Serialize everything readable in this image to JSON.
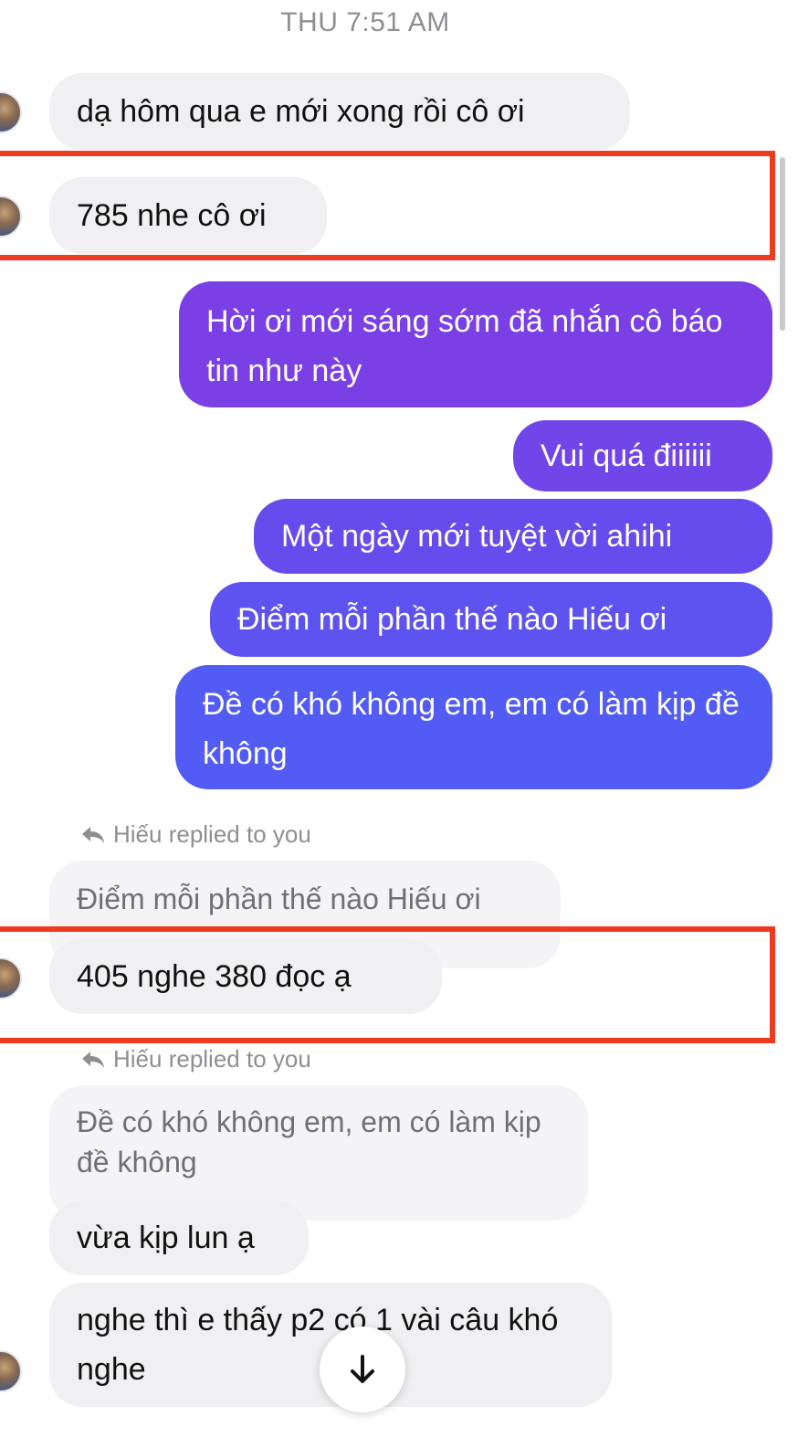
{
  "header": {
    "timestamp": "THU 7:51 AM"
  },
  "messages": [
    {
      "text": "dạ hôm qua e mới xong rồi cô ơi"
    },
    {
      "text": "785 nhe cô ơi"
    },
    {
      "text": "Hời ơi mới sáng sớm đã nhắn cô báo tin như này"
    },
    {
      "text": "Vui quá điiiiii"
    },
    {
      "text": "Một ngày mới tuyệt vời ahihi"
    },
    {
      "text": "Điểm mỗi phần thế nào Hiếu ơi"
    },
    {
      "text": "Đề có khó không em, em có làm kịp đề không"
    },
    {
      "reply_label": "Hiếu replied to you",
      "quote": "Điểm mỗi phần thế nào Hiếu ơi",
      "text": "405 nghe 380 đọc ạ"
    },
    {
      "reply_label": "Hiếu replied to you",
      "quote": "Đề có khó không em, em có làm kịp đề không",
      "text": "vừa kịp lun ạ"
    },
    {
      "text": "nghe thì e thấy p2 có 1 vài câu khó nghe"
    }
  ],
  "icons": {
    "reply": "reply-arrow-icon",
    "scroll_down": "arrow-down-icon"
  },
  "colors": {
    "highlight": "#ee3a1e",
    "outgoing_top": "#7b3fe4",
    "outgoing_bottom": "#4f5df4",
    "incoming": "#f0f0f2"
  }
}
